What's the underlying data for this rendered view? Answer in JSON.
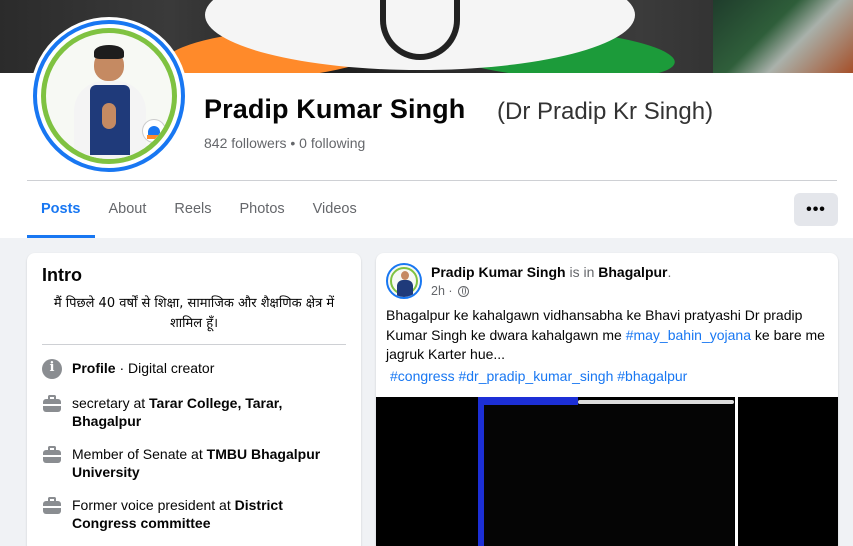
{
  "profile": {
    "name": "Pradip Kumar Singh",
    "alt_name": "(Dr Pradip Kr Singh)",
    "stats": "842 followers • 0 following"
  },
  "tabs": [
    {
      "label": "Posts",
      "active": true
    },
    {
      "label": "About",
      "active": false
    },
    {
      "label": "Reels",
      "active": false
    },
    {
      "label": "Photos",
      "active": false
    },
    {
      "label": "Videos",
      "active": false
    }
  ],
  "more_button": "•••",
  "intro": {
    "title": "Intro",
    "bio": "मैं पिछले 40 वर्षों से शिक्षा, सामाजिक और शैक्षणिक क्षेत्र में शामिल हूँ।",
    "items": [
      {
        "icon": "info-icon",
        "prefix": "",
        "bold": "Profile",
        "suffix": " · Digital creator"
      },
      {
        "icon": "briefcase-icon",
        "prefix": "secretary at ",
        "bold": "Tarar College, Tarar, Bhagalpur",
        "suffix": ""
      },
      {
        "icon": "briefcase-icon",
        "prefix": "Member of Senate at ",
        "bold": "TMBU Bhagalpur University",
        "suffix": ""
      },
      {
        "icon": "briefcase-icon",
        "prefix": "Former voice president at ",
        "bold": "District Congress committee",
        "suffix": ""
      }
    ]
  },
  "post": {
    "author": "Pradip Kumar Singh",
    "is_in": "is in",
    "place": "Bhagalpur",
    "place_suffix": ".",
    "time": "2h",
    "text_before": "Bhagalpur ke kahalgawn vidhansabha ke Bhavi pratyashi Dr pradip Kumar Singh ke dwara kahalgawn me ",
    "text_hashtag": "#may_bahin_yojana",
    "text_after": " ke bare me jagruk Karter hue...",
    "tags": "#congress #dr_pradip_kumar_singh #bhagalpur"
  },
  "colors": {
    "accent": "#1877f2",
    "ring_green": "#7fc241",
    "background": "#f0f2f5"
  }
}
